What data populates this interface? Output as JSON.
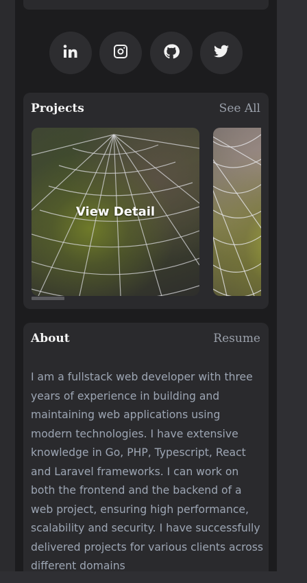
{
  "social": {
    "items": [
      {
        "name": "linkedin-icon",
        "label": "LinkedIn"
      },
      {
        "name": "instagram-icon",
        "label": "Instagram"
      },
      {
        "name": "github-icon",
        "label": "GitHub"
      },
      {
        "name": "twitter-icon",
        "label": "Twitter"
      }
    ]
  },
  "projects": {
    "title": "Projects",
    "see_all_label": "See All",
    "tiles": [
      {
        "overlay_label": "View Detail"
      },
      {
        "overlay_label": ""
      }
    ]
  },
  "about": {
    "title": "About",
    "resume_label": "Resume",
    "body": "I am a fullstack web developer with three years of experience in building and maintaining web applications using modern technologies. I have extensive knowledge in Go, PHP, Typescript, React and Laravel frameworks. I can work on both the frontend and the backend of a web project, ensuring high performance, scalability and security. I have successfully delivered projects for various clients across different domains"
  },
  "colors": {
    "page_bg": "#1c1c1e",
    "card_bg": "#2a2a2d",
    "button_bg": "#2d2d30",
    "text_primary": "#f3f3f3",
    "text_muted": "#9aa0aa",
    "body_text": "#9da6b4"
  }
}
